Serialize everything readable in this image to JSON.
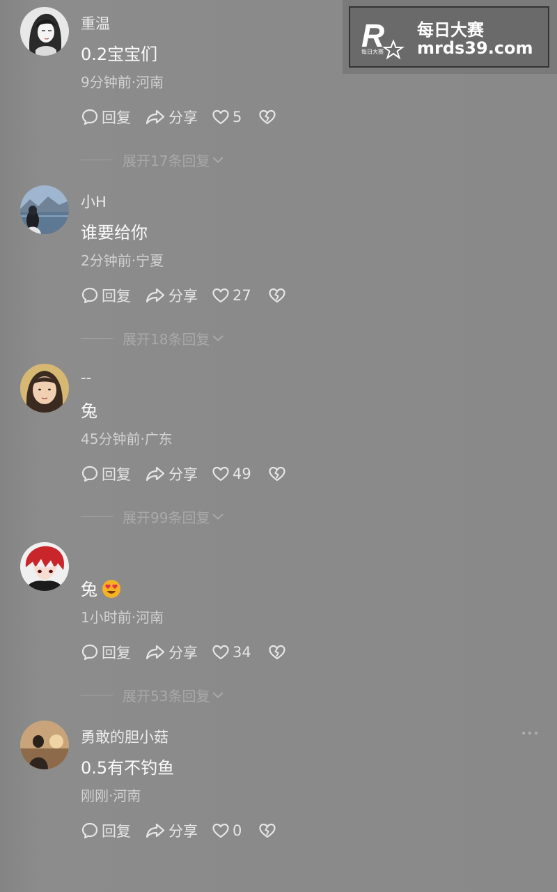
{
  "watermark": {
    "logo_letter": "R",
    "logo_subtext": "每日大赛",
    "title": "每日大赛",
    "url": "mrds39.com"
  },
  "labels": {
    "reply": "回复",
    "share": "分享"
  },
  "comments": [
    {
      "username": "重温",
      "content": "0.2宝宝们",
      "meta": "9分钟前·河南",
      "likes": "5",
      "expand": "展开17条回复"
    },
    {
      "username": "小H",
      "content": "谁要给你",
      "meta": "2分钟前·宁夏",
      "likes": "27",
      "expand": "展开18条回复"
    },
    {
      "username": "--",
      "content": "兔",
      "meta": "45分钟前·广东",
      "likes": "49",
      "expand": "展开99条回复"
    },
    {
      "username": "",
      "content": "兔",
      "emoji": "heart-eyes-emoji",
      "meta": "1小时前·河南",
      "likes": "34",
      "expand": "展开53条回复"
    },
    {
      "username": "勇敢的胆小菇",
      "content": "0.5有不钓鱼",
      "meta": "刚刚·河南",
      "likes": "0"
    }
  ],
  "icons": {
    "reply": "speech-bubble-icon",
    "share": "share-arrow-icon",
    "like": "heart-icon",
    "dislike": "broken-heart-icon",
    "expand": "chevron-down-icon",
    "more": "more-dots-icon"
  },
  "colors": {
    "background": "#898989",
    "text_primary": "#fbfbfb",
    "text_secondary": "#d2d2d2",
    "expand_text": "#a9a9a9"
  }
}
